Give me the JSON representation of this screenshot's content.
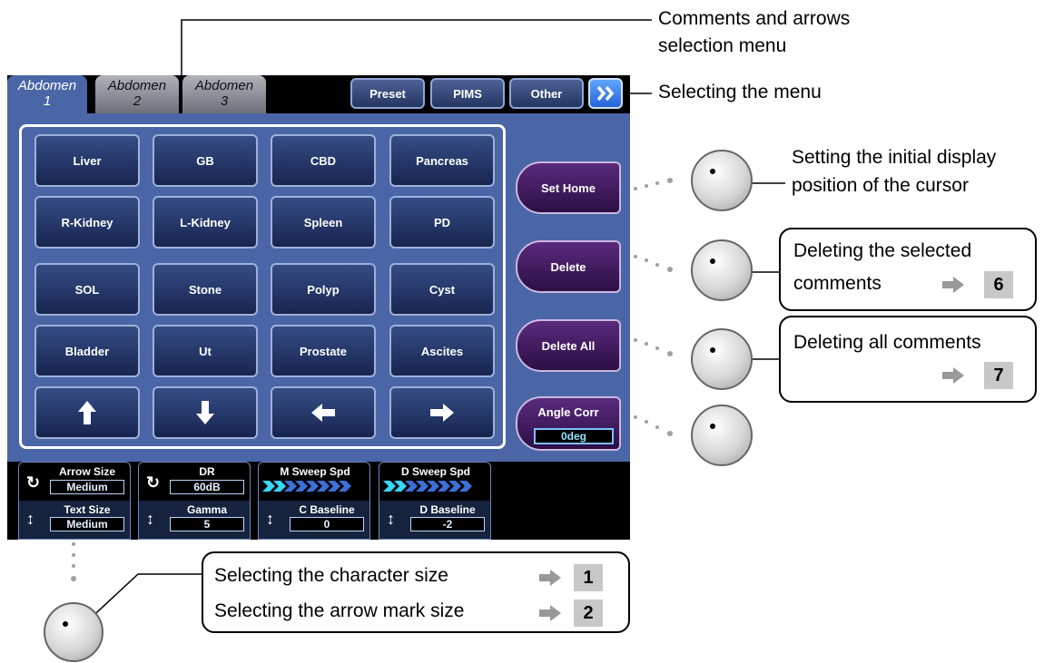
{
  "tabs": [
    {
      "line1": "Abdomen",
      "line2": "1"
    },
    {
      "line1": "Abdomen",
      "line2": "2"
    },
    {
      "line1": "Abdomen",
      "line2": "3"
    }
  ],
  "top_buttons": {
    "preset": "Preset",
    "pims": "PIMS",
    "other": "Other"
  },
  "comment_buttons": [
    [
      "Liver",
      "GB",
      "CBD",
      "Pancreas"
    ],
    [
      "R-Kidney",
      "L-Kidney",
      "Spleen",
      "PD"
    ],
    [
      "SOL",
      "Stone",
      "Polyp",
      "Cyst"
    ],
    [
      "Bladder",
      "Ut",
      "Prostate",
      "Ascites"
    ]
  ],
  "arrow_buttons": [
    "up",
    "down",
    "left",
    "right"
  ],
  "side_buttons": {
    "set_home": "Set Home",
    "delete": "Delete",
    "delete_all": "Delete All",
    "angle_corr": "Angle Corr",
    "angle_value": "0deg"
  },
  "controls": [
    {
      "top_label": "Arrow Size",
      "top_value": "Medium",
      "bottom_label": "Text Size",
      "bottom_value": "Medium"
    },
    {
      "top_label": "DR",
      "top_value": "60dB",
      "bottom_label": "Gamma",
      "bottom_value": "5"
    },
    {
      "top_label": "M Sweep Spd",
      "bottom_label": "C Baseline",
      "bottom_value": "0"
    },
    {
      "top_label": "D Sweep Spd",
      "bottom_label": "D Baseline",
      "bottom_value": "-2"
    }
  ],
  "annotations": {
    "comments_menu_line1": "Comments and arrows",
    "comments_menu_line2": "selection menu",
    "selecting_menu": "Selecting the menu",
    "set_home_line1": "Setting the initial display",
    "set_home_line2": "position of the cursor",
    "delete_line1": "Deleting the selected",
    "delete_line2": "comments",
    "delete_ref": "6",
    "delete_all_line1": "Deleting all comments",
    "delete_all_ref": "7",
    "char_size": "Selecting the character size",
    "char_size_ref": "1",
    "arrow_size": "Selecting the arrow mark size",
    "arrow_size_ref": "2"
  },
  "colors": {
    "panel_blue": "#4a66a7",
    "button_navy": "#1f2f5c",
    "side_purple": "#3f1a5a",
    "accent_cyan": "#35d6ff"
  }
}
